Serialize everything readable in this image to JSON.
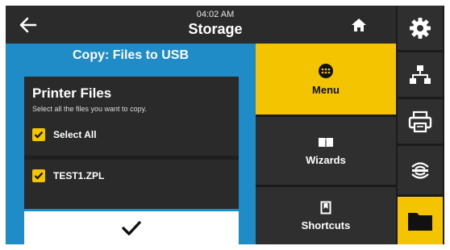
{
  "header": {
    "time": "04:02 AM",
    "title": "Storage",
    "back_icon": "arrow-left-icon",
    "home_icon": "home-icon"
  },
  "panel": {
    "title": "Copy: Files to USB",
    "files_heading": "Printer Files",
    "files_description": "Select all the files you want to copy.",
    "items": [
      {
        "label": "Select All",
        "checked": true
      },
      {
        "label": "TEST1.ZPL",
        "checked": true
      }
    ],
    "confirm_icon": "checkmark-icon"
  },
  "nav": {
    "items": [
      {
        "label": "Menu",
        "icon": "menu-dots-icon",
        "active": true
      },
      {
        "label": "Wizards",
        "icon": "book-icon",
        "active": false
      },
      {
        "label": "Shortcuts",
        "icon": "bookmark-icon",
        "active": false
      }
    ]
  },
  "rail": {
    "items": [
      {
        "icon": "gear-icon"
      },
      {
        "icon": "network-icon"
      },
      {
        "icon": "printer-icon"
      },
      {
        "icon": "wireless-icon"
      },
      {
        "icon": "folder-icon",
        "active": true
      }
    ]
  },
  "colors": {
    "accent": "#f5c400",
    "panel_blue": "#1f8bc7",
    "dark": "#2b2b2b"
  }
}
